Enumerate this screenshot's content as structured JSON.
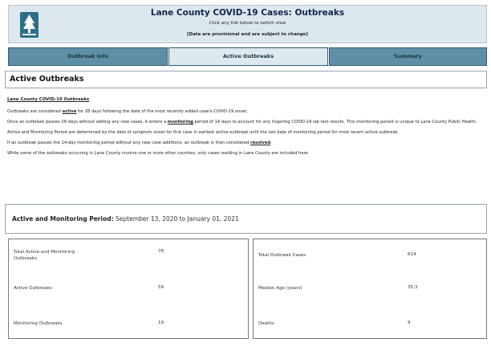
{
  "header": {
    "title": "Lane County COVID-19 Cases: Outbreaks",
    "subtitle": "Click any link below to switch view",
    "note": "[Data are provisional and are subject to change]",
    "logo_icon": "lane-county-tree-logo"
  },
  "tabs": [
    {
      "label": "Outbreak Info",
      "active": false
    },
    {
      "label": "Active Outbreaks",
      "active": true
    },
    {
      "label": "Summary",
      "active": false
    }
  ],
  "section": {
    "heading": "Active Outbreaks"
  },
  "info": {
    "subheading": "Lane County COVID-19 Outbreaks",
    "p1": {
      "before": "Outbreaks are considered ",
      "bold": "active",
      "after": " for 28 days following the date of the most recently added case's COVID-19 onset."
    },
    "p2": {
      "before": "Once an outbreak passes 28 days without adding any new cases, it enters a ",
      "bold": "monitoring",
      "after": " period of 14 days to account for any lingering COVID-19 lab test results. This monitoring period is unique to Lane County Public Health."
    },
    "p3": "Active and Monitoring Period are determined by the date of symptom onset for first case in earliest active outbreak until the last date of monitoring period for most recent active outbreak.",
    "p4": {
      "before": "If an outbreak passes the 14-day monitoring period without any new case additions, an outbreak is then considered ",
      "bold": "resolved",
      "after": "."
    },
    "p5": "While some of the outbreaks occurring in Lane County involve one or more other counties, only cases residing in Lane County are included here."
  },
  "period": {
    "label": "Active and Monitoring Period:",
    "value": "September 13, 2020 to January 01, 2021"
  },
  "stats_left": [
    {
      "label": "Total Active and Monitoring Outbreaks",
      "value": "78"
    },
    {
      "label": "Active Outbreaks",
      "value": "59"
    },
    {
      "label": "Monitoring Outbreaks",
      "value": "19"
    }
  ],
  "stats_right": [
    {
      "label": "Total Outbreak Cases",
      "value": "614"
    },
    {
      "label": "Median Age (years)",
      "value": "35.3"
    },
    {
      "label": "Deaths",
      "value": "9"
    }
  ],
  "colors": {
    "header_bg": "#dde7ee",
    "tab_bg": "#5f8fa6",
    "tab_active_bg": "#dde9ef",
    "title_color": "#10264c"
  }
}
